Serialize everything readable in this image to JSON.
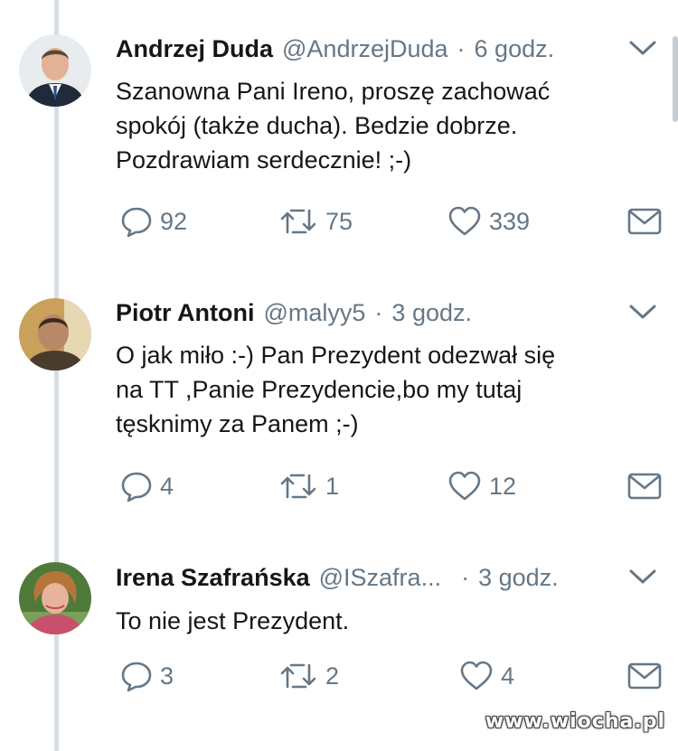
{
  "tweets": [
    {
      "name": "Andrzej Duda",
      "handle": "@AndrzejDuda",
      "separator": "·",
      "time": "6 godz.",
      "lines": [
        "Szanowna Pani Ireno, proszę zachować",
        "spokój (także ducha). Bedzie dobrze.",
        "Pozdrawiam serdecznie! ;-)"
      ],
      "replies": "92",
      "retweets": "75",
      "likes": "339"
    },
    {
      "name": "Piotr Antoni",
      "handle": "@malyy5",
      "separator": "·",
      "time": "3 godz.",
      "lines": [
        "O jak miło :-) Pan Prezydent odezwał się",
        "na TT ,Panie Prezydencie,bo my tutaj",
        "tęsknimy za Panem ;-)"
      ],
      "replies": "4",
      "retweets": "1",
      "likes": "12"
    },
    {
      "name": "Irena Szafrańska",
      "handle": "@ISzafra...",
      "separator": "·",
      "time": "3 godz.",
      "lines": [
        "To nie jest Prezydent."
      ],
      "replies": "3",
      "retweets": "2",
      "likes": "4"
    }
  ],
  "icons": {
    "reply": "speech-bubble-icon",
    "retweet": "retweet-arrows-icon",
    "like": "heart-icon",
    "message": "envelope-icon",
    "menu": "chevron-down-icon"
  },
  "colors": {
    "text": "#14171a",
    "secondary": "#657786",
    "thread_line": "#d8dee3"
  },
  "watermark": "www.wiocha.pl"
}
